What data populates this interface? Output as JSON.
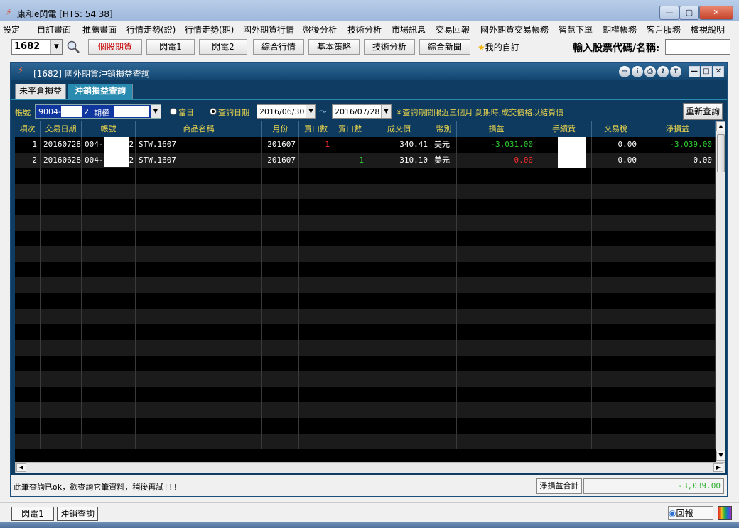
{
  "window": {
    "title": "康和e閃電 [HTS: 54 38]"
  },
  "menu": [
    "設定",
    "自訂畫面",
    "推薦畫面",
    "行情走勢(證)",
    "行情走勢(期)",
    "國外期貨行情",
    "盤後分析",
    "技術分析",
    "市場訊息",
    "交易回報",
    "國外期貨交易帳務",
    "智慧下單",
    "期權帳務",
    "客戶服務",
    "檢視說明"
  ],
  "toolbar": {
    "stock_code": "1682",
    "buttons": [
      "個股期貨",
      "閃電1",
      "閃電2",
      "綜合行情",
      "基本策略",
      "技術分析",
      "綜合新聞"
    ],
    "favorites_label": "我的自訂",
    "prompt": "輸入股票代碼/名稱:",
    "input_value": ""
  },
  "inner_window": {
    "title": "[1682] 國外期貨沖銷損益查詢",
    "tabs": [
      "未平倉損益",
      "沖銷損益查詢"
    ],
    "active_tab": 1
  },
  "query": {
    "account_label": "帳號",
    "account_prefix": "9004-",
    "account_suffix": "2",
    "futures_label": "期權",
    "radio_today": "當日",
    "radio_range": "查詢日期",
    "selected_radio": "range",
    "date_from": "2016/06/30",
    "date_sep": "～",
    "date_to": "2016/07/28",
    "notice": "※查詢期間限近三個月 到期時,成交價格以結算價",
    "refresh_label": "重新查詢"
  },
  "table": {
    "columns": [
      "項次",
      "交易日期",
      "帳號",
      "商品名稱",
      "月份",
      "買口數",
      "賣口數",
      "成交價",
      "幣別",
      "損益",
      "手續費",
      "交易稅",
      "淨損益"
    ],
    "rows": [
      {
        "no": "1",
        "date": "20160728",
        "acct_a": "004-",
        "acct_b": "2",
        "product": "STW.1607",
        "month": "201607",
        "buy": "1",
        "sell": "",
        "price": "340.41",
        "currency": "美元",
        "pnl": "-3,031.00",
        "fee": "",
        "tax": "0.00",
        "net": "-3,039.00"
      },
      {
        "no": "2",
        "date": "20160628",
        "acct_a": "004-",
        "acct_b": "2",
        "product": "STW.1607",
        "month": "201607",
        "buy": "",
        "sell": "1",
        "price": "310.10",
        "currency": "美元",
        "pnl": "0.00",
        "fee": "",
        "tax": "0.00",
        "net": "0.00"
      }
    ]
  },
  "status": {
    "message": "此筆查詢已ok，欲查詢它筆資料，稍後再試!!!",
    "net_total_label": "淨損益合計",
    "net_total_value": "-3,039.00"
  },
  "bottom": {
    "tabs": [
      "閃電1",
      "沖銷查詢"
    ],
    "report_label": "回報"
  },
  "colors": {
    "header_text": "#e8d44c",
    "loss": "#2fd12f",
    "gain": "#ff2b2b",
    "panel_bg": "#0f3c62"
  }
}
